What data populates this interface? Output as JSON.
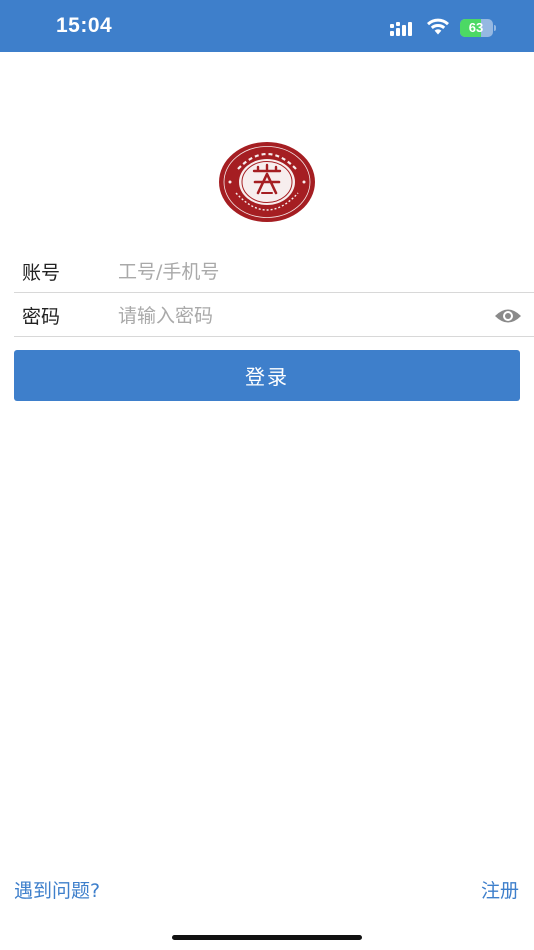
{
  "status_bar": {
    "time": "15:04",
    "battery_level": "63",
    "battery_fraction": 0.63,
    "battery_color": "#4cd964"
  },
  "logo": {
    "icon": "school-seal-logo",
    "color": "#a51e22"
  },
  "form": {
    "account_label": "账号",
    "account_placeholder": "工号/手机号",
    "account_value": "",
    "password_label": "密码",
    "password_placeholder": "请输入密码",
    "password_value": "",
    "visibility_icon": "eye-icon"
  },
  "login_button_label": "登录",
  "footer": {
    "help_link": "遇到问题?",
    "register_link": "注册"
  },
  "colors": {
    "accent": "#3e7fcb",
    "divider": "#d8d8d8",
    "placeholder": "#a9a9a9"
  }
}
